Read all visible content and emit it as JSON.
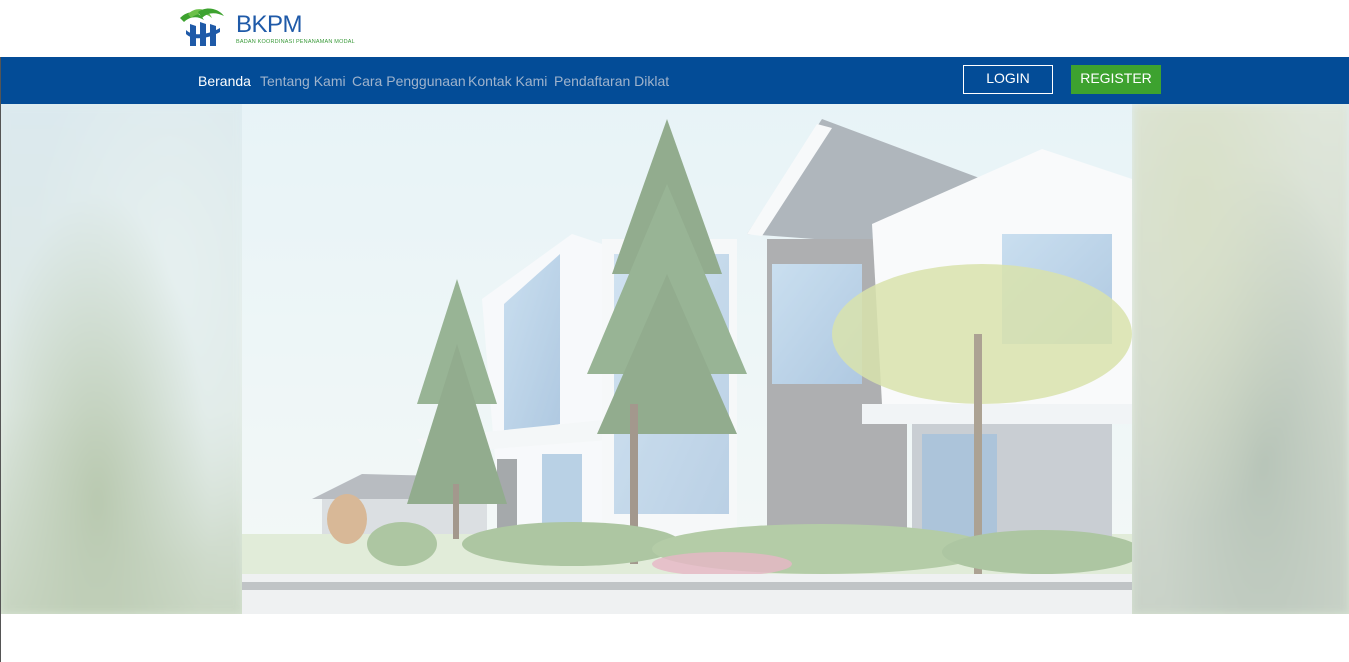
{
  "brand": {
    "name": "BKPM",
    "tagline": "BADAN KOORDINASI PENANAMAN MODAL"
  },
  "nav": {
    "items": [
      {
        "label": "Beranda",
        "active": true
      },
      {
        "label": "Tentang Kami",
        "active": false
      },
      {
        "label": "Cara Penggunaan",
        "active": false
      },
      {
        "label": "Kontak Kami",
        "active": false
      },
      {
        "label": "Pendaftaran Diklat",
        "active": false
      }
    ],
    "login_label": "LOGIN",
    "register_label": "REGISTER"
  },
  "colors": {
    "nav_bg": "#034c97",
    "register_bg": "#3da22f",
    "brand_blue": "#1f5aa8",
    "brand_green": "#3a9a3a"
  }
}
